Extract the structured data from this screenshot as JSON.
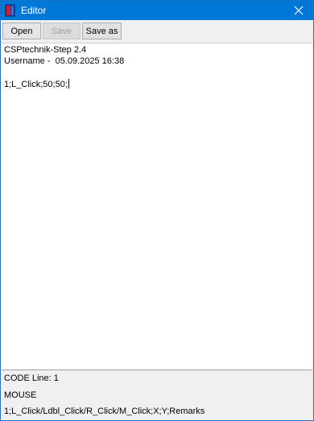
{
  "window": {
    "title": "Editor",
    "title_bar_color": "#0078d7",
    "app_icon": "document-book-icon",
    "close_icon": "close-icon"
  },
  "toolbar": {
    "open_label": "Open",
    "save_label": "Save",
    "save_enabled": false,
    "save_as_label": "Save as"
  },
  "editor": {
    "lines": [
      "CSPtechnik-Step 2.4",
      "Username -  05.09.2025 16:38",
      "",
      "1;L_Click;50;50;"
    ]
  },
  "status": {
    "code_line": "CODE Line: 1",
    "command": "MOUSE",
    "syntax": "1;L_Click/Ldbl_Click/R_Click/M_Click;X;Y;Remarks"
  }
}
